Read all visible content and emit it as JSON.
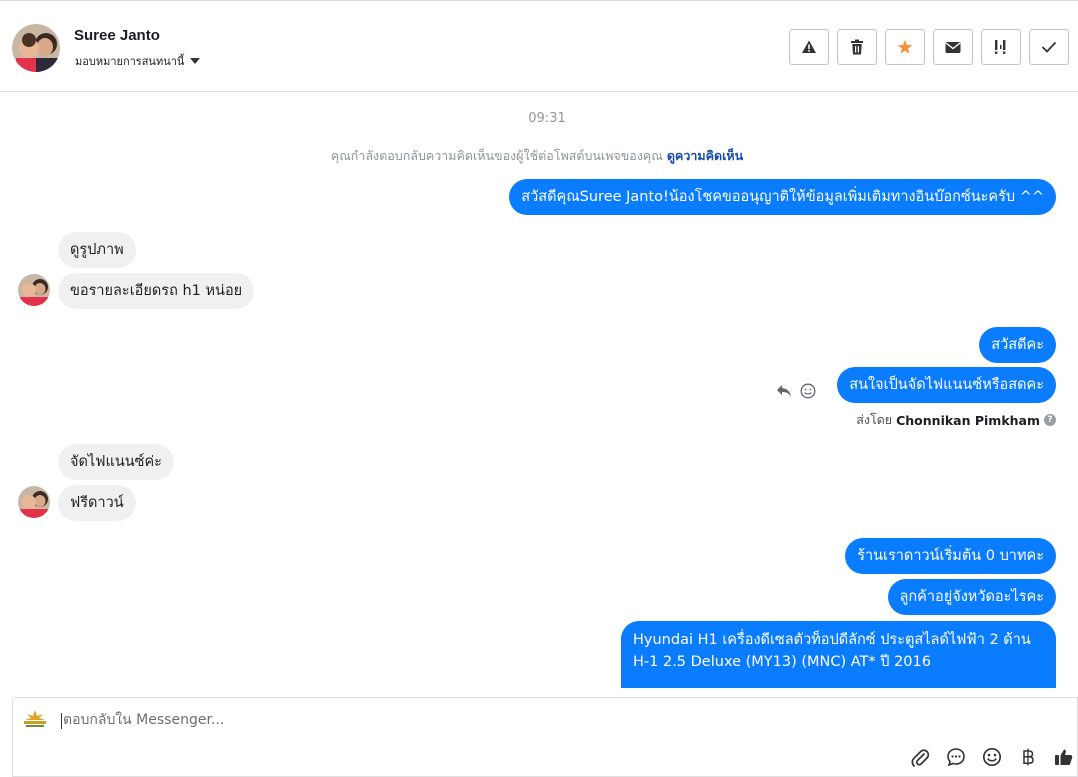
{
  "header": {
    "contact_name": "Suree Janto",
    "assign_label": "มอบหมายการสนทนานี้",
    "toolbar": [
      {
        "icon": "warning-icon"
      },
      {
        "icon": "trash-icon"
      },
      {
        "icon": "star-icon",
        "color": "#f7923a"
      },
      {
        "icon": "envelope-icon"
      },
      {
        "icon": "priority-icon"
      },
      {
        "icon": "check-icon"
      }
    ]
  },
  "conversation": {
    "timestamp": "09:31",
    "notice_text": "คุณกำลังตอบกลับความคิดเห็นของผู้ใช้ต่อโพสต์บนเพจของคุณ",
    "notice_link": "ดูความคิดเห็น",
    "messages": [
      {
        "dir": "out",
        "text": "สวัสดีคุณSuree Janto!น้องโชคขออนุญาติให้ข้อมูลเพิ่มเติมทางอินบ๊อกซ์นะครับ ^^"
      },
      {
        "dir": "in",
        "text": "ดูรูปภาพ"
      },
      {
        "dir": "in",
        "text": "ขอรายละเอียดรถ h1 หน่อย"
      },
      {
        "dir": "out",
        "text": "สวัสดีคะ"
      },
      {
        "dir": "out",
        "text": "สนใจเป็นจัดไฟแนนซ์หรือสดคะ"
      },
      {
        "dir": "in",
        "text": "จัดไฟแนนซ์ค่ะ"
      },
      {
        "dir": "in",
        "text": "ฟรีดาวน์"
      },
      {
        "dir": "out",
        "text": "ร้านเราดาวน์เริ่มต้น 0 บาทคะ"
      },
      {
        "dir": "out",
        "text": "ลูกค้าอยู่จังหวัดอะไรคะ"
      },
      {
        "dir": "out",
        "text_line1": "Hyundai H1 เครื่องดีเซลตัวท็อปดีลักซ์ ประตูสไลด์ไฟฟ้า 2 ด้าน",
        "text_line2": "H-1 2.5 Deluxe (MY13) (MNC) AT* ปี 2016"
      }
    ],
    "sent_by_prefix": "ส่งโดย",
    "sent_by_name": "Chonnikan Pimkham"
  },
  "composer": {
    "placeholder": "ตอบกลับใน Messenger...",
    "value": "",
    "tools": [
      "attachment-icon",
      "saved-reply-icon",
      "emoji-icon",
      "baht-icon",
      "thumbs-up-icon"
    ]
  },
  "colors": {
    "outgoing": "#0a7cff",
    "incoming": "#f0f0f0",
    "link": "#1a4aa8"
  }
}
